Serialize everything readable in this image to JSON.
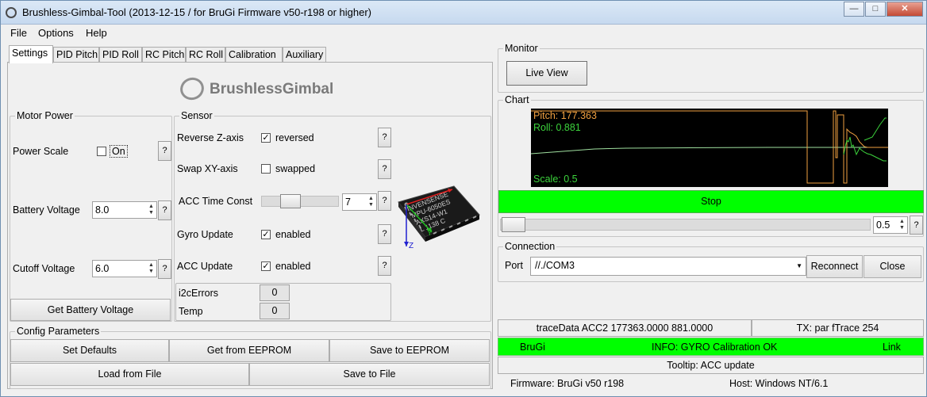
{
  "window": {
    "title": "Brushless-Gimbal-Tool (2013-12-15 / for BruGi Firmware v50-r198 or higher)",
    "controls": {
      "minimize": "—",
      "maximize": "□",
      "close": "✕"
    }
  },
  "menu": [
    "File",
    "Options",
    "Help"
  ],
  "tabs": [
    "Settings",
    "PID Pitch",
    "PID Roll",
    "RC Pitch",
    "RC Roll",
    "Calibration",
    "Auxiliary"
  ],
  "logo": {
    "text": "BrushlessGimbal"
  },
  "motor_power": {
    "title": "Motor Power",
    "power_scale_label": "Power Scale",
    "power_scale_checkbox": "On",
    "power_scale_checked": false,
    "battery_voltage_label": "Battery Voltage",
    "battery_voltage_value": "8.0",
    "cutoff_voltage_label": "Cutoff Voltage",
    "cutoff_voltage_value": "6.0",
    "get_battery_button": "Get Battery Voltage",
    "help": "?"
  },
  "sensor": {
    "title": "Sensor",
    "reverse_z_label": "Reverse Z-axis",
    "reverse_z_checkbox": "reversed",
    "reverse_z_checked": true,
    "swap_xy_label": "Swap XY-axis",
    "swap_xy_checkbox": "swapped",
    "swap_xy_checked": false,
    "acc_time_label": "ACC Time Const",
    "acc_time_value": "7",
    "gyro_update_label": "Gyro Update",
    "gyro_update_checkbox": "enabled",
    "gyro_update_checked": true,
    "acc_update_label": "ACC Update",
    "acc_update_checkbox": "enabled",
    "acc_update_checked": true,
    "i2c_errors_label": "i2cErrors",
    "i2c_errors_value": "0",
    "temp_label": "Temp",
    "temp_value": "0",
    "help": "?",
    "chip_text": [
      "INVENSENSE",
      "MPU-6050ES",
      "AXS14-W1",
      "L 1138 C"
    ],
    "chip_axis_y": "Y",
    "chip_axis_z": "Z"
  },
  "config": {
    "title": "Config Parameters",
    "set_defaults": "Set Defaults",
    "get_eeprom": "Get from EEPROM",
    "save_eeprom": "Save to EEPROM",
    "load_file": "Load from File",
    "save_file": "Save to File"
  },
  "monitor": {
    "title": "Monitor",
    "live_view": "Live View"
  },
  "chart": {
    "title": "Chart",
    "pitch_text": "Pitch: 177.363",
    "roll_text": "Roll:  0.881",
    "scale_text": "Scale:  0.5",
    "stop_button": "Stop",
    "scale_value": "0.5",
    "help": "?",
    "colors": {
      "pitch": "#f0a040",
      "roll": "#3cd23c",
      "baseline": "#9fdf9f"
    }
  },
  "connection": {
    "title": "Connection",
    "port_label": "Port",
    "port_value": "//./COM3",
    "reconnect": "Reconnect",
    "close": "Close"
  },
  "status": {
    "trace": "traceData ACC2 177363.0000 881.0000",
    "tx": "TX: par fTrace 254",
    "left": "BruGi",
    "info": "INFO: GYRO Calibration OK",
    "right": "Link",
    "tooltip": "Tooltip: ACC update",
    "firmware": "Firmware: BruGi v50 r198",
    "host": "Host: Windows NT/6.1",
    "colors": {
      "ok": "#00ff00"
    }
  }
}
